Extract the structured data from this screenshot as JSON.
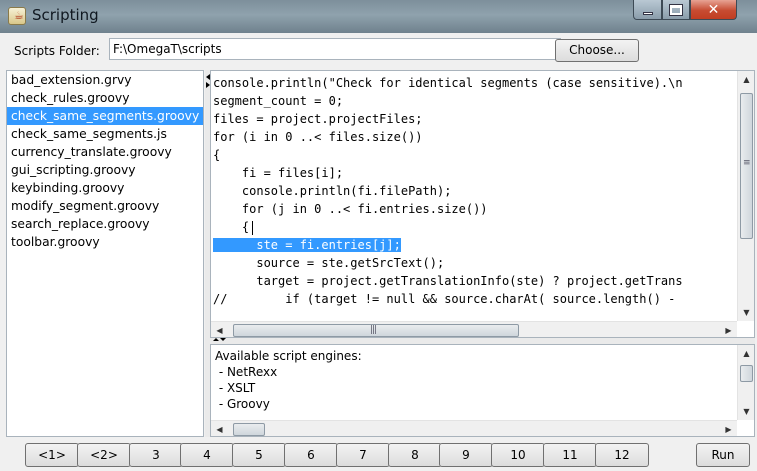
{
  "window": {
    "title": "Scripting",
    "app_icon": "java-cup-icon"
  },
  "folder": {
    "label": "Scripts Folder:",
    "value": "F:\\OmegaT\\scripts",
    "choose_label": "Choose..."
  },
  "scripts": [
    "bad_extension.grvy",
    "check_rules.groovy",
    "check_same_segments.groovy",
    "check_same_segments.js",
    "currency_translate.groovy",
    "gui_scripting.groovy",
    "keybinding.groovy",
    "modify_segment.groovy",
    "search_replace.groovy",
    "toolbar.groovy"
  ],
  "selected_script_index": 2,
  "editor": {
    "highlighted_line": 8,
    "lines": [
      "console.println(\"Check for identical segments (case sensitive).\\n",
      "segment_count = 0;",
      "files = project.projectFiles;",
      "for (i in 0 ..< files.size())",
      "{",
      "    fi = files[i];",
      "    console.println(fi.filePath);",
      "    for (j in 0 ..< fi.entries.size())",
      "      ste = fi.entries[j];",
      "      source = ste.getSrcText();",
      "      target = project.getTranslationInfo(ste) ? project.getTrans",
      "//        if (target != null && source.charAt( source.length() -",
      "        "
    ],
    "brace_line": "    {"
  },
  "output": {
    "lines": [
      "Available script engines:",
      " - NetRexx",
      " - XSLT",
      " - Groovy"
    ]
  },
  "buttons": [
    "<1>",
    "<2>",
    "3",
    "4",
    "5",
    "6",
    "7",
    "8",
    "9",
    "10",
    "11",
    "12"
  ],
  "run_label": "Run",
  "colors": {
    "selection": "#3399ff",
    "titlebar": "#8fa2ad",
    "close": "#c74c32"
  }
}
